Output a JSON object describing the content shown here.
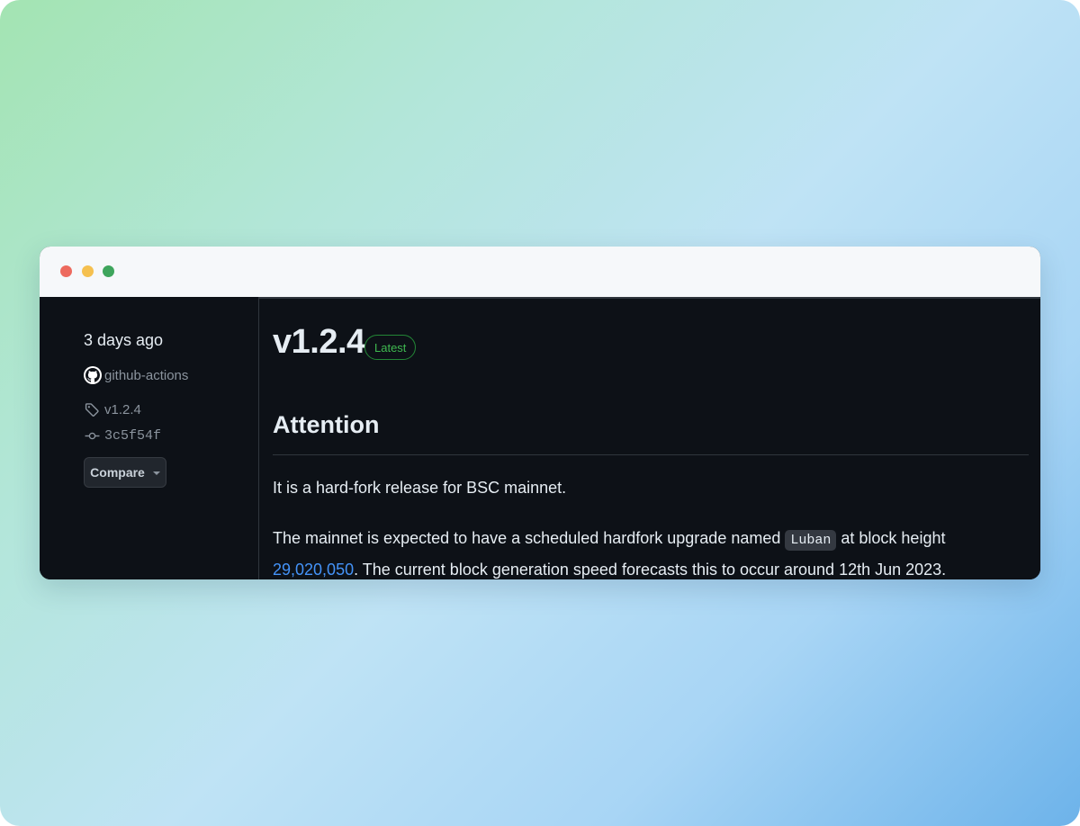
{
  "release": {
    "date": "3 days ago",
    "author": "github-actions",
    "tag": "v1.2.4",
    "commit": "3c5f54f",
    "compare_label": "Compare",
    "title": "v1.2.4",
    "badge": "Latest"
  },
  "notes": {
    "heading": "Attention",
    "para1": "It is a hard-fork release for BSC mainnet.",
    "para2_before_code": "The mainnet is expected to have a scheduled hardfork upgrade named ",
    "code_name": "Luban",
    "para2_between": " at block height ",
    "block_height": "29,020,050",
    "para2_after": ". The current block generation speed forecasts this to occur around 12th Jun 2023."
  },
  "icons": {
    "avatar": "github-icon",
    "tag": "tag-icon",
    "commit": "git-commit-icon",
    "caret": "caret-down-icon"
  },
  "colors": {
    "background": "#0d1117",
    "text": "#e6edf3",
    "muted": "#8b949e",
    "link": "#4493f8",
    "badge": "#3fb950",
    "titlebar": "#f6f8fa"
  }
}
